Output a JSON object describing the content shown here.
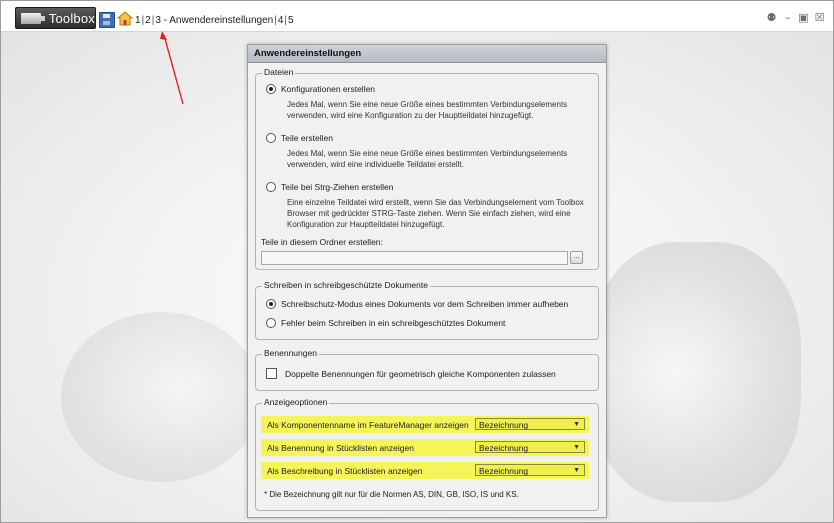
{
  "topbar": {
    "app_label": "Toolbox",
    "breadcrumb": [
      "1",
      "2",
      "3 - Anwendereinstellungen",
      "4",
      "5"
    ],
    "window_controls": [
      "pin-icon",
      "minimize-icon",
      "maximize-icon",
      "close-icon"
    ]
  },
  "dialog": {
    "title": "Anwendereinstellungen",
    "dateien": {
      "legend": "Dateien",
      "options": [
        {
          "label": "Konfigurationen erstellen",
          "selected": true,
          "desc": "Jedes Mal, wenn Sie eine neue Größe eines bestimmten Verbindungselements verwenden, wird eine Konfiguration zu der Hauptteildatei hinzugefügt."
        },
        {
          "label": "Teile erstellen",
          "selected": false,
          "desc": "Jedes Mal, wenn Sie eine neue Größe eines bestimmten Verbindungselements verwenden, wird eine individuelle Teildatei erstellt."
        },
        {
          "label": "Teile bei Strg-Ziehen erstellen",
          "selected": false,
          "desc": "Eine einzelne Teildatei wird erstellt, wenn Sie das Verbindungselement vom Toolbox Browser mit gedrückter STRG-Taste ziehen. Wenn Sie einfach ziehen, wird eine Konfiguration zur Hauptteildatei hinzugefügt."
        }
      ],
      "folder_label": "Teile in diesem Ordner erstellen:",
      "folder_value": "",
      "browse_label": "..."
    },
    "schreibschutz": {
      "legend": "Schreiben in schreibgeschützte Dokumente",
      "options": [
        {
          "label": "Schreibschutz-Modus eines Dokuments vor dem Schreiben immer aufheben",
          "selected": true
        },
        {
          "label": "Fehler beim Schreiben in ein schreibgeschütztes Dokument",
          "selected": false
        }
      ]
    },
    "benennungen": {
      "legend": "Benennungen",
      "checkbox_label": "Doppelte Benennungen für geometrisch gleiche Komponenten zulassen",
      "checked": false
    },
    "anzeige": {
      "legend": "Anzeigeoptionen",
      "rows": [
        {
          "label": "Als Komponentenname im FeatureManager anzeigen",
          "value": "Bezeichnung"
        },
        {
          "label": "Als Benennung in Stücklisten anzeigen",
          "value": "Bezeichnung"
        },
        {
          "label": "Als Beschreibung in Stücklisten anzeigen",
          "value": "Bezeichnung"
        }
      ],
      "footnote": "* Die Bezeichnung gilt nur für die Normen AS, DIN, GB, ISO, IS und KS."
    }
  },
  "colors": {
    "highlight": "#f5f559",
    "annotation_arrow": "#e02020"
  }
}
